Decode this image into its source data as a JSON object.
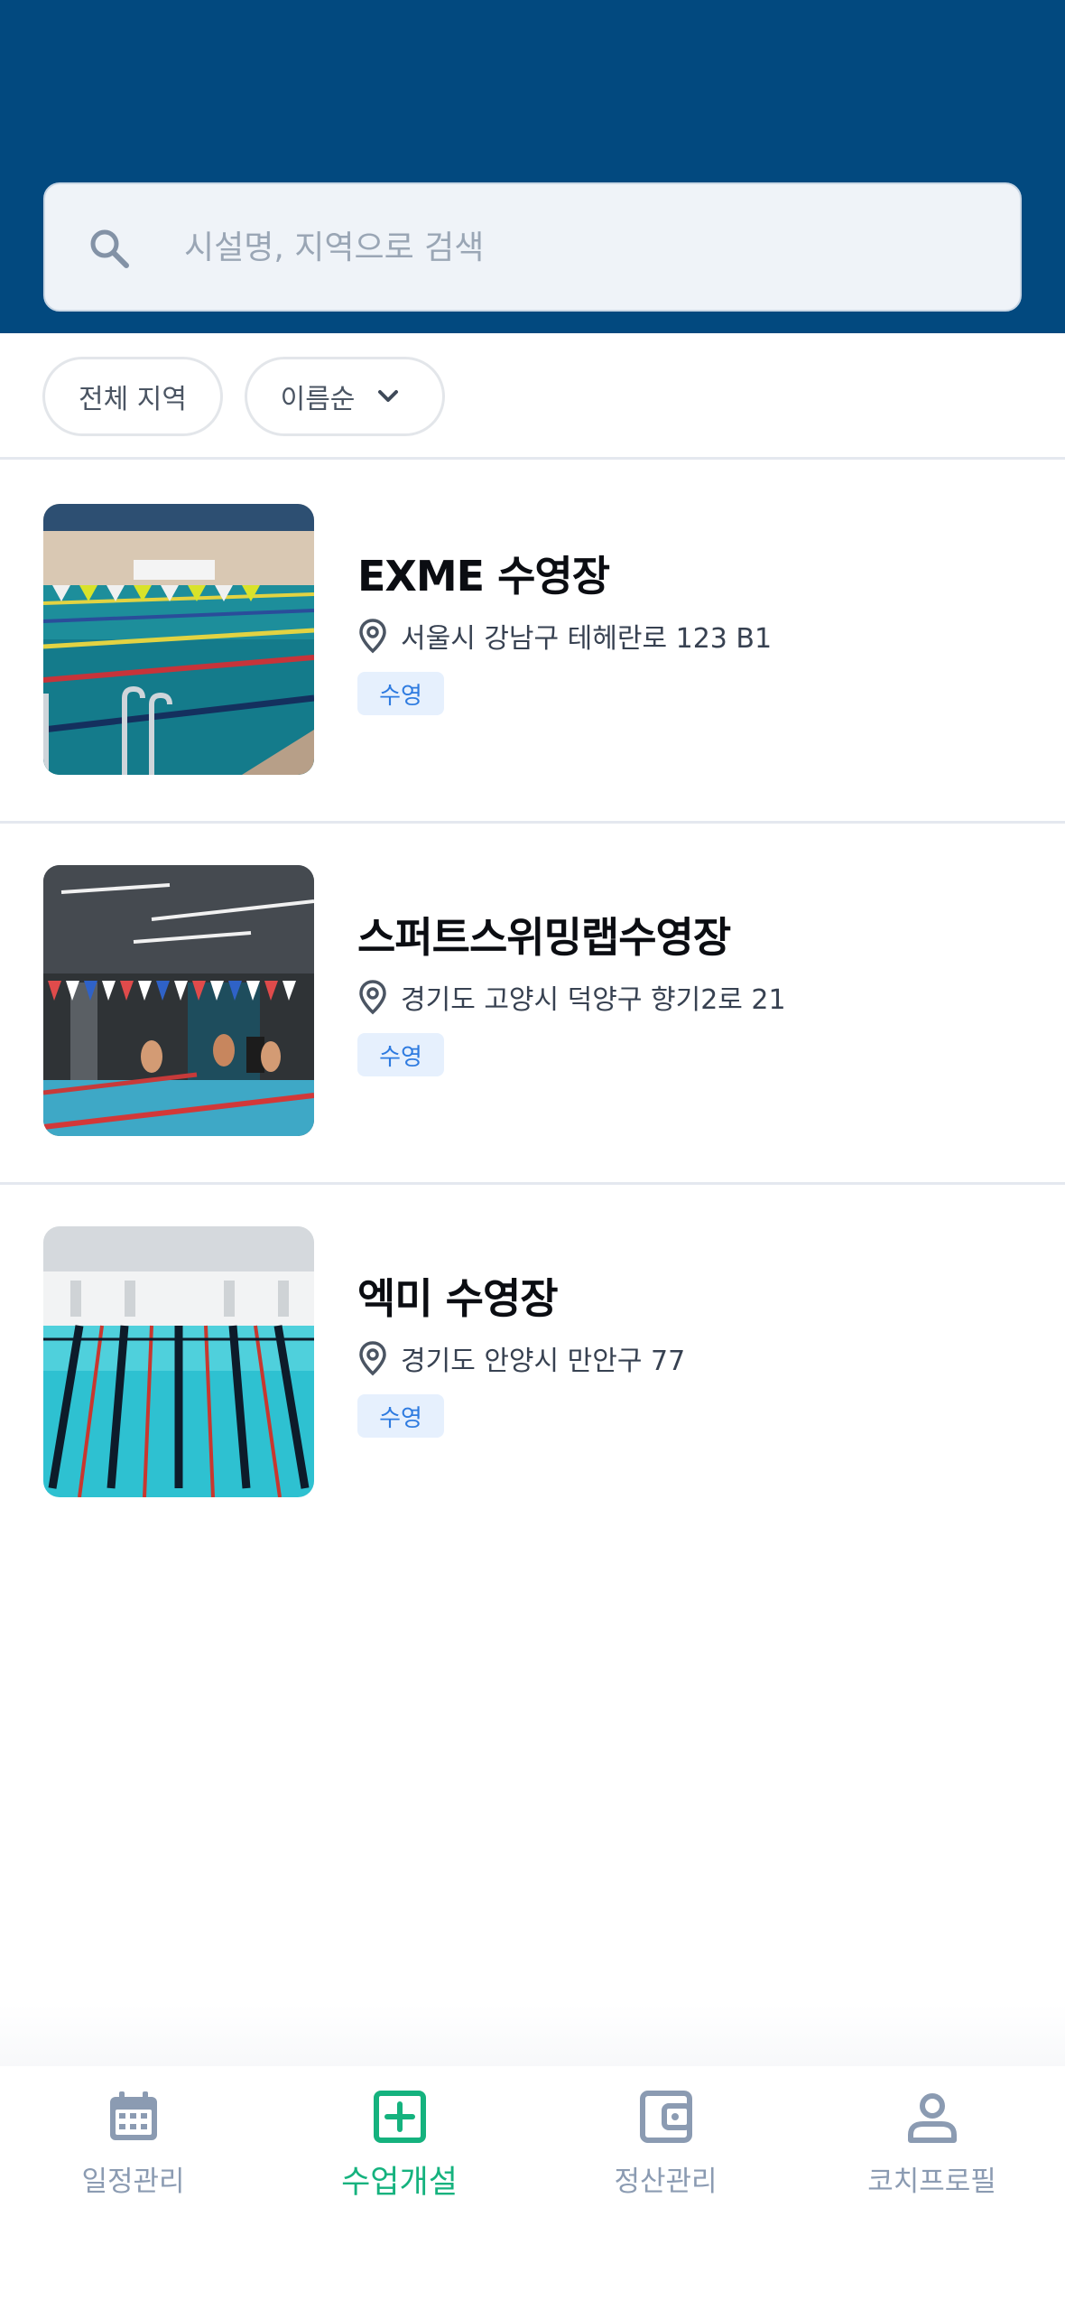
{
  "search": {
    "placeholder": "시설명, 지역으로 검색",
    "icon": "search-icon"
  },
  "filters": {
    "region_label": "전체 지역",
    "sort_label": "이름순",
    "sort_icon": "chevron-down-icon"
  },
  "facilities": [
    {
      "name": "EXME 수영장",
      "address": "서울시 강남구 테헤란로 123 B1",
      "tag": "수영",
      "image": "indoor-pool-photo"
    },
    {
      "name": "스퍼트스위밍랩수영장",
      "address": "경기도 고양시 덕양구 향기2로 21",
      "tag": "수영",
      "image": "swimmers-pool-photo"
    },
    {
      "name": "엑미 수영장",
      "address": "경기도 안양시 만안구 77",
      "tag": "수영",
      "image": "lane-pool-photo"
    }
  ],
  "tabbar": {
    "items": [
      {
        "label": "일정관리",
        "icon": "calendar-icon",
        "active": false
      },
      {
        "label": "수업개설",
        "icon": "plus-square-icon",
        "active": true
      },
      {
        "label": "정산관리",
        "icon": "wallet-icon",
        "active": false
      },
      {
        "label": "코치프로필",
        "icon": "person-icon",
        "active": false
      }
    ]
  },
  "colors": {
    "header": "#02497f",
    "accent": "#15b27e",
    "tag_bg": "#e6f0fd",
    "tag_text": "#2e7be0",
    "inactive_tab": "#8b9bb2"
  }
}
